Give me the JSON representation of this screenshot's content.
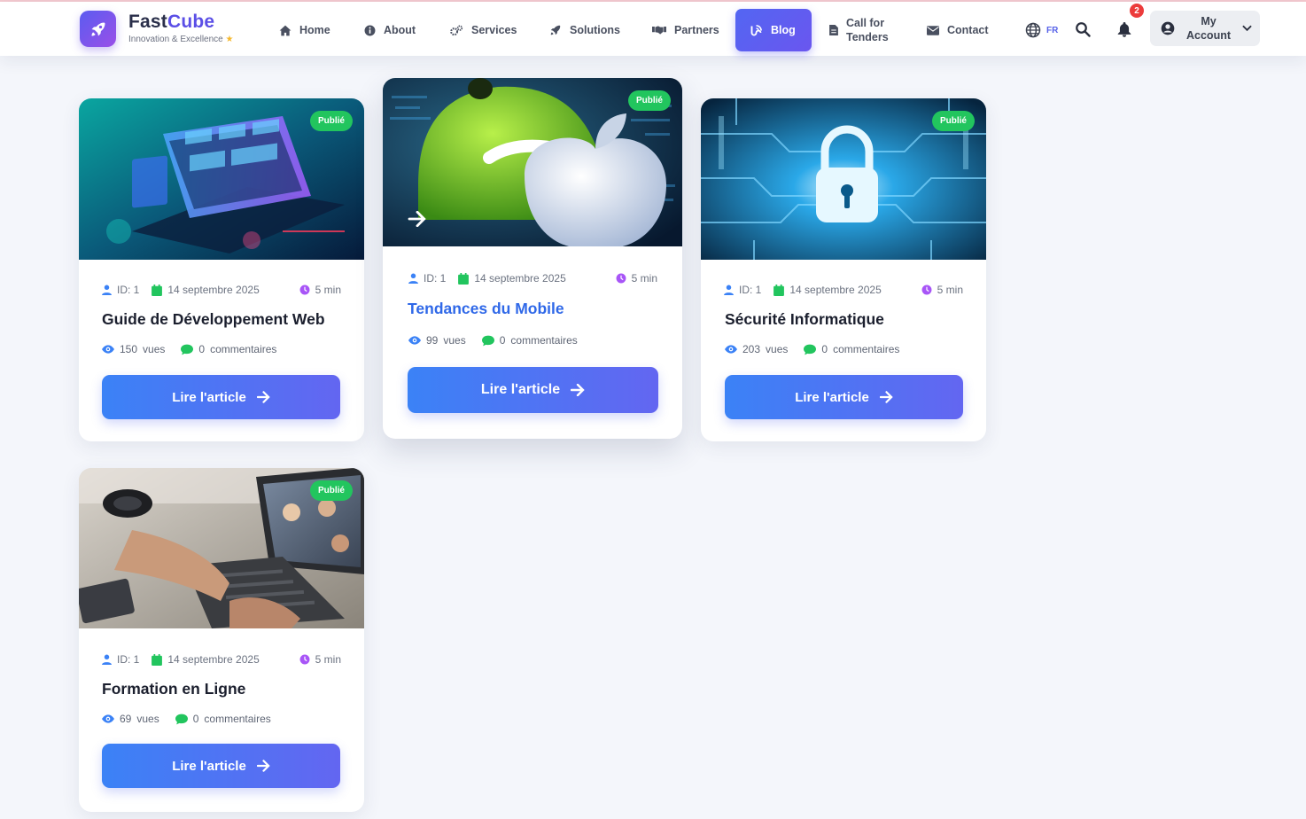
{
  "brand": {
    "name_part1": "Fast",
    "name_part2": "Cube",
    "tagline": "Innovation & Excellence",
    "star": "★"
  },
  "nav": {
    "home": "Home",
    "about": "About",
    "services": "Services",
    "solutions": "Solutions",
    "partners": "Partners",
    "blog": "Blog",
    "call_for_tenders_line1": "Call for",
    "call_for_tenders_line2": "Tenders",
    "contact": "Contact",
    "language": "FR",
    "notifications_count": "2",
    "account_line1": "My",
    "account_line2": "Account"
  },
  "colors": {
    "accent": "#5b4fe6",
    "published": "#22c55e",
    "button_start": "#3b82f6",
    "button_end": "#6366f1",
    "link_title": "#2f68e8"
  },
  "articles": [
    {
      "status": "Publié",
      "id_label": "ID: 1",
      "date": "14 septembre 2025",
      "read_time": "5 min",
      "title": "Guide de Développement Web",
      "views": "150",
      "views_label": "vues",
      "comments": "0",
      "comments_label": "commentaires",
      "button": "Lire l'article"
    },
    {
      "status": "Publié",
      "id_label": "ID: 1",
      "date": "14 septembre 2025",
      "read_time": "5 min",
      "title": "Tendances du Mobile",
      "views": "99",
      "views_label": "vues",
      "comments": "0",
      "comments_label": "commentaires",
      "button": "Lire l'article"
    },
    {
      "status": "Publié",
      "id_label": "ID: 1",
      "date": "14 septembre 2025",
      "read_time": "5 min",
      "title": "Sécurité Informatique",
      "views": "203",
      "views_label": "vues",
      "comments": "0",
      "comments_label": "commentaires",
      "button": "Lire l'article"
    },
    {
      "status": "Publié",
      "id_label": "ID: 1",
      "date": "14 septembre 2025",
      "read_time": "5 min",
      "title": "Formation en Ligne",
      "views": "69",
      "views_label": "vues",
      "comments": "0",
      "comments_label": "commentaires",
      "button": "Lire l'article"
    }
  ]
}
